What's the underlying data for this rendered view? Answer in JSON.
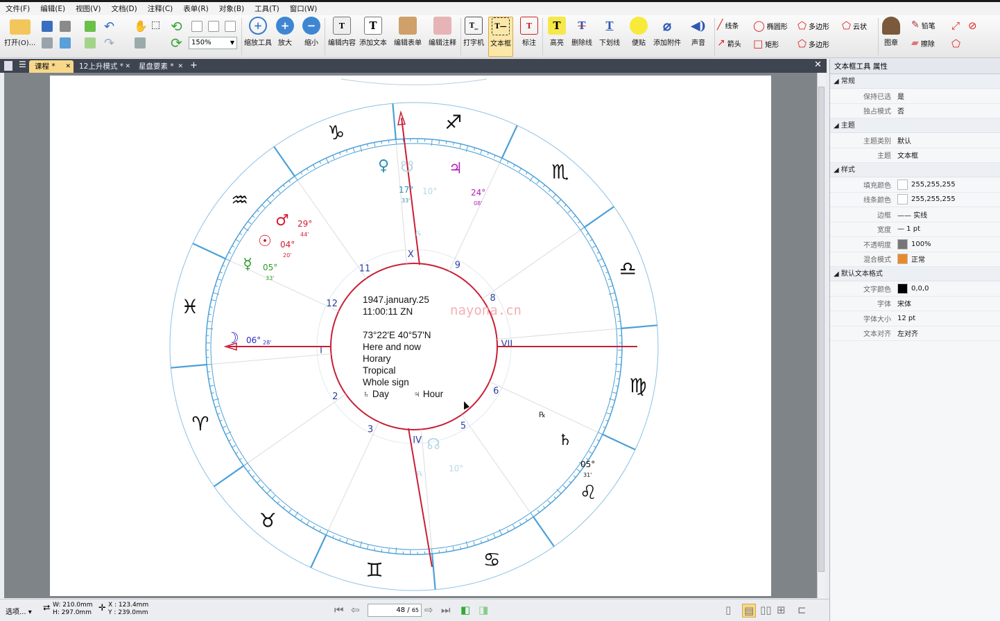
{
  "menu": [
    "文件(F)",
    "编辑(E)",
    "视图(V)",
    "文档(D)",
    "注释(C)",
    "表单(R)",
    "对象(B)",
    "工具(T)",
    "窗口(W)"
  ],
  "toolbar": {
    "open_label": "打开(O)...",
    "zoom_value": "150%",
    "zoom_tool": "缩放工具",
    "zoom_in": "放大",
    "zoom_out": "缩小",
    "edit_content": "编辑内容",
    "add_text": "添加文本",
    "edit_form": "编辑表单",
    "edit_annotation": "编辑注释",
    "typewriter": "打字机",
    "textbox": "文本框",
    "callout": "标注",
    "highlight": "高亮",
    "strikeout": "删除线",
    "underline": "下划线",
    "note": "便贴",
    "attach": "添加附件",
    "sound": "声音",
    "line": "线条",
    "ellipse": "椭圆形",
    "polygon": "多边形",
    "cloud": "云状",
    "arrow": "箭头",
    "rect": "矩形",
    "polyline": "多边形",
    "stamp": "图章",
    "pencil": "铅笔",
    "eraser": "擦除"
  },
  "tabs": [
    {
      "label": "课程 *",
      "active": true
    },
    {
      "label": "12上升模式 *",
      "active": false
    },
    {
      "label": "星盘要素 *",
      "active": false
    }
  ],
  "chart_text": {
    "date": "1947.january.25",
    "time": "11:00:11 ZN",
    "coords": "73°22'E  40°57'N",
    "line1": "Here and now",
    "line2": "Horary",
    "line3": "Tropical",
    "line4": "Whole sign",
    "day": "♄ Day",
    "hour": "♃ Hour",
    "houses": [
      "I",
      "2",
      "3",
      "IV",
      "5",
      "6",
      "VII",
      "8",
      "9",
      "X",
      "11",
      "12"
    ],
    "signs": [
      "♐",
      "♏",
      "♎",
      "♍",
      "♌",
      "♋",
      "♊",
      "♉",
      "♈",
      "♓",
      "♒",
      "♑"
    ],
    "planets": [
      {
        "glyph": "♀",
        "deg": "17°",
        "min": "33'",
        "color": "#2a8fb5"
      },
      {
        "glyph": "☋",
        "deg": "10°",
        "min": "",
        "color": "#b5d8e6"
      },
      {
        "glyph": "♃",
        "deg": "24°",
        "min": "08'",
        "color": "#b21fb5"
      },
      {
        "glyph": "♂",
        "deg": "29°",
        "min": "44'",
        "color": "#d21a2e"
      },
      {
        "glyph": "☉",
        "deg": "04°",
        "min": "20'",
        "color": "#d21a2e"
      },
      {
        "glyph": "☿",
        "deg": "05°",
        "min": "33'",
        "color": "#2a9b2a"
      },
      {
        "glyph": "☽",
        "deg": "06°",
        "min": "28'",
        "color": "#2b2bc2"
      },
      {
        "glyph": "♄",
        "deg": "05°",
        "min": "31'",
        "color": "#111111"
      },
      {
        "glyph": "☊",
        "deg": "10°",
        "min": "",
        "color": "#b5d8e6"
      }
    ],
    "retro": "℞",
    "watermark": "nayona.cn"
  },
  "panel": {
    "title": "文本框工具 属性",
    "sections": [
      {
        "name": "常规",
        "rows": [
          {
            "k": "保持已选",
            "v": "是"
          },
          {
            "k": "独占模式",
            "v": "否"
          }
        ]
      },
      {
        "name": "主题",
        "rows": [
          {
            "k": "主题类别",
            "v": "默认"
          },
          {
            "k": "主题",
            "v": "文本框"
          }
        ]
      },
      {
        "name": "样式",
        "rows": [
          {
            "k": "填充颜色",
            "v": "255,255,255",
            "swatch": "#ffffff"
          },
          {
            "k": "线条颜色",
            "v": "255,255,255",
            "swatch": "#ffffff"
          },
          {
            "k": "边框",
            "v": "—— 实线"
          },
          {
            "k": "宽度",
            "v": "— 1 pt"
          },
          {
            "k": "不透明度",
            "v": "100%",
            "swatch": "#777777"
          },
          {
            "k": "混合模式",
            "v": "正常",
            "swatch": "#e98a2a"
          }
        ]
      },
      {
        "name": "默认文本格式",
        "rows": [
          {
            "k": "文字颜色",
            "v": "0,0,0",
            "swatch": "#000000"
          },
          {
            "k": "字体",
            "v": "宋体"
          },
          {
            "k": "字体大小",
            "v": "12 pt"
          },
          {
            "k": "文本对齐",
            "v": "左对齐"
          }
        ]
      }
    ]
  },
  "status": {
    "view": "选项...",
    "width": "W: 210.0mm",
    "height": "H: 297.0mm",
    "x": "X : 123.4mm",
    "y": "Y : 239.0mm",
    "page_current": "48",
    "page_total": "65"
  }
}
